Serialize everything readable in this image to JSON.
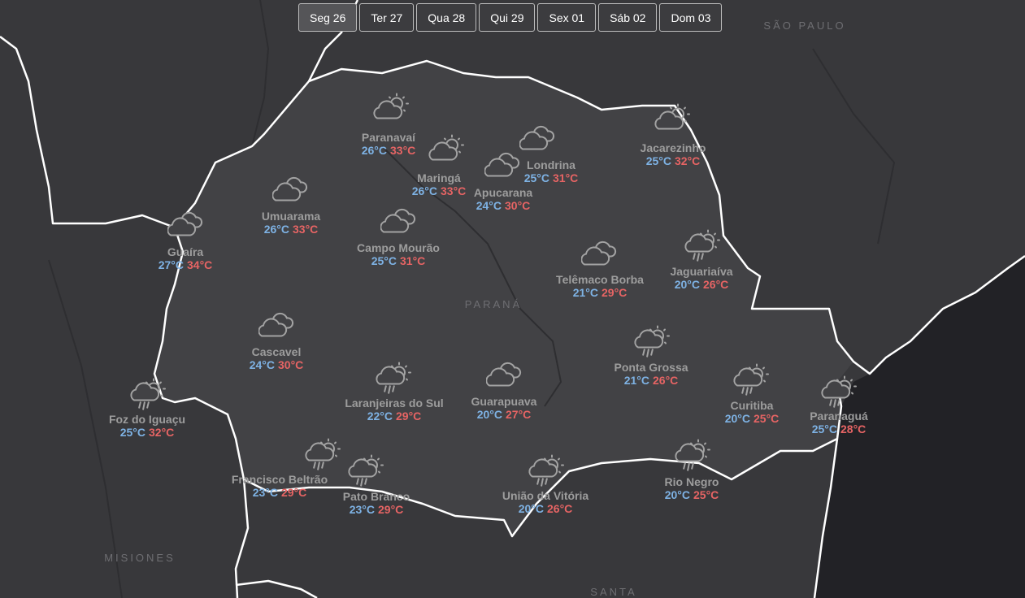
{
  "days": [
    {
      "label": "Seg 26",
      "active": true
    },
    {
      "label": "Ter 27",
      "active": false
    },
    {
      "label": "Qua 28",
      "active": false
    },
    {
      "label": "Qui 29",
      "active": false
    },
    {
      "label": "Sex 01",
      "active": false
    },
    {
      "label": "Sáb 02",
      "active": false
    },
    {
      "label": "Dom 03",
      "active": false
    }
  ],
  "regions": [
    "SÃO PAULO",
    "PARANÁ",
    "MISIONES",
    "SANTA"
  ],
  "colors": {
    "min": "#7eb2e4",
    "max": "#e66464",
    "name": "#9d9d9d",
    "land": "#3c3c3f",
    "ocean": "#222226",
    "border": "#ffffff"
  },
  "cities": [
    {
      "name": "Paranavaí",
      "min": "26°C",
      "max": "33°C",
      "icon": "partly-cloudy-icon"
    },
    {
      "name": "Maringá",
      "min": "26°C",
      "max": "33°C",
      "icon": "partly-cloudy-icon"
    },
    {
      "name": "Londrina",
      "min": "25°C",
      "max": "31°C",
      "icon": "cloudy-icon"
    },
    {
      "name": "Apucarana",
      "min": "24°C",
      "max": "30°C",
      "icon": "cloudy-icon"
    },
    {
      "name": "Jacarezinho",
      "min": "25°C",
      "max": "32°C",
      "icon": "partly-cloudy-icon"
    },
    {
      "name": "Umuarama",
      "min": "26°C",
      "max": "33°C",
      "icon": "cloudy-icon"
    },
    {
      "name": "Guaíra",
      "min": "27°C",
      "max": "34°C",
      "icon": "cloudy-icon"
    },
    {
      "name": "Campo Mourão",
      "min": "25°C",
      "max": "31°C",
      "icon": "cloudy-icon"
    },
    {
      "name": "Telêmaco Borba",
      "min": "21°C",
      "max": "29°C",
      "icon": "cloudy-icon"
    },
    {
      "name": "Jaguariaíva",
      "min": "20°C",
      "max": "26°C",
      "icon": "rain-sun-icon"
    },
    {
      "name": "Cascavel",
      "min": "24°C",
      "max": "30°C",
      "icon": "cloudy-icon"
    },
    {
      "name": "Ponta Grossa",
      "min": "21°C",
      "max": "26°C",
      "icon": "rain-sun-icon"
    },
    {
      "name": "Laranjeiras do Sul",
      "min": "22°C",
      "max": "29°C",
      "icon": "rain-sun-icon"
    },
    {
      "name": "Guarapuava",
      "min": "20°C",
      "max": "27°C",
      "icon": "cloudy-icon"
    },
    {
      "name": "Curitiba",
      "min": "20°C",
      "max": "25°C",
      "icon": "rain-sun-icon"
    },
    {
      "name": "Paranaguá",
      "min": "25°C",
      "max": "28°C",
      "icon": "rain-sun-icon"
    },
    {
      "name": "Foz do Iguaçu",
      "min": "25°C",
      "max": "32°C",
      "icon": "rain-sun-icon"
    },
    {
      "name": "Francisco Beltrão",
      "min": "23°C",
      "max": "29°C",
      "icon": "rain-sun-icon"
    },
    {
      "name": "Pato Branco",
      "min": "23°C",
      "max": "29°C",
      "icon": "rain-sun-icon"
    },
    {
      "name": "União da Vitória",
      "min": "20°C",
      "max": "26°C",
      "icon": "rain-sun-icon"
    },
    {
      "name": "Rio Negro",
      "min": "20°C",
      "max": "25°C",
      "icon": "rain-sun-icon"
    }
  ]
}
